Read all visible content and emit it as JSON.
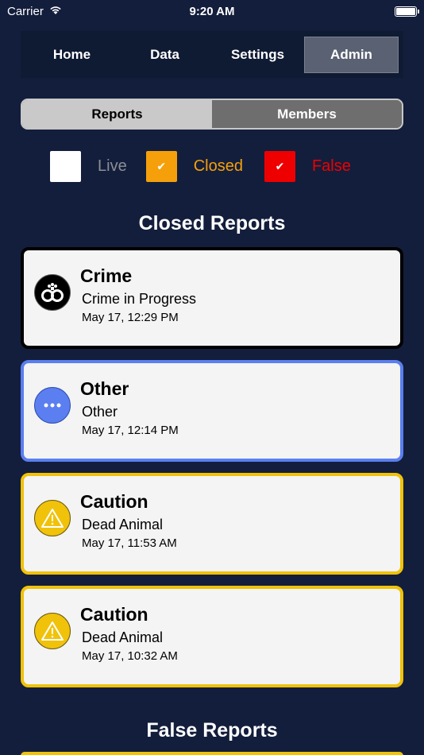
{
  "status_bar": {
    "carrier": "Carrier",
    "time": "9:20 AM"
  },
  "nav": {
    "tabs": [
      {
        "label": "Home",
        "active": false
      },
      {
        "label": "Data",
        "active": false
      },
      {
        "label": "Settings",
        "active": false
      },
      {
        "label": "Admin",
        "active": true
      }
    ]
  },
  "segment": {
    "reports_label": "Reports",
    "members_label": "Members",
    "selected": "Reports"
  },
  "filters": {
    "live": {
      "label": "Live",
      "checked": false,
      "color": "#8d8f95"
    },
    "closed": {
      "label": "Closed",
      "checked": true,
      "color": "#f5a00a"
    },
    "false": {
      "label": "False",
      "checked": true,
      "color": "#ee0000"
    }
  },
  "closed_section": {
    "title": "Closed Reports",
    "reports": [
      {
        "category": "Crime",
        "description": "Crime in Progress",
        "time": "May 17, 12:29 PM",
        "icon": "handcuffs-icon",
        "border_color": "#000000"
      },
      {
        "category": "Other",
        "description": "Other",
        "time": "May 17, 12:14 PM",
        "icon": "ellipsis-icon",
        "border_color": "#5b7ff0"
      },
      {
        "category": "Caution",
        "description": "Dead Animal",
        "time": "May 17, 11:53 AM",
        "icon": "warning-icon",
        "border_color": "#f0c20a"
      },
      {
        "category": "Caution",
        "description": "Dead Animal",
        "time": "May 17, 10:32 AM",
        "icon": "warning-icon",
        "border_color": "#f0c20a"
      }
    ]
  },
  "false_section": {
    "title": "False Reports"
  },
  "colors": {
    "background": "#131e3c",
    "nav_active": "#5a6172"
  }
}
